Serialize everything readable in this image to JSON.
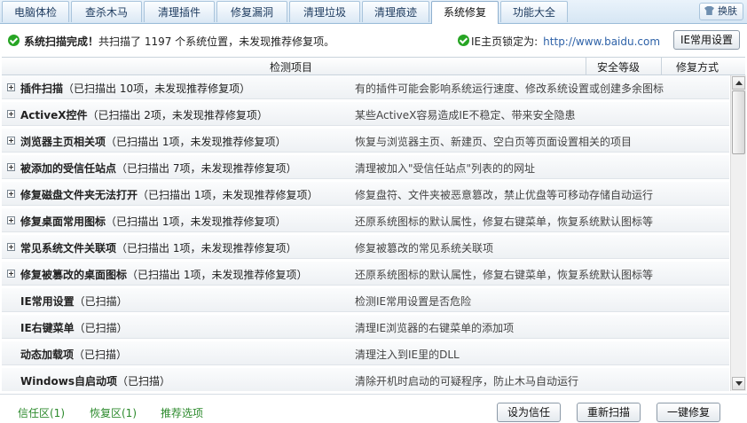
{
  "tabs": [
    {
      "label": "电脑体检"
    },
    {
      "label": "查杀木马"
    },
    {
      "label": "清理插件"
    },
    {
      "label": "修复漏洞"
    },
    {
      "label": "清理垃圾"
    },
    {
      "label": "清理痕迹"
    },
    {
      "label": "系统修复",
      "active": true
    },
    {
      "label": "功能大全"
    }
  ],
  "skin_label": "换肤",
  "status": {
    "title": "系统扫描完成！",
    "message": "共扫描了 1197 个系统位置，未发现推荐修复项。",
    "ie_lock_label": "IE主页锁定为:",
    "ie_url": "http://www.baidu.com",
    "ie_settings_button": "IE常用设置"
  },
  "columns": {
    "item": "检测项目",
    "level": "安全等级",
    "method": "修复方式"
  },
  "rows": [
    {
      "name": "插件扫描",
      "detail": "（已扫描出 10项，未发现推荐修复项）",
      "desc": "有的插件可能会影响系统运行速度、修改系统设置或创建多余图标",
      "expandable": true
    },
    {
      "name": "ActiveX控件",
      "detail": "（已扫描出 2项，未发现推荐修复项）",
      "desc": "某些ActiveX容易造成IE不稳定、带来安全隐患",
      "expandable": true
    },
    {
      "name": "浏览器主页相关项",
      "detail": "（已扫描出 1项，未发现推荐修复项）",
      "desc": "恢复与浏览器主页、新建页、空白页等页面设置相关的项目",
      "expandable": true
    },
    {
      "name": "被添加的受信任站点",
      "detail": "（已扫描出 7项，未发现推荐修复项）",
      "desc": "清理被加入\"受信任站点\"列表的的网址",
      "expandable": true
    },
    {
      "name": "修复磁盘文件夹无法打开",
      "detail": "（已扫描出 1项，未发现推荐修复项）",
      "desc": "修复盘符、文件夹被恶意篡改，禁止优盘等可移动存储自动运行",
      "expandable": true
    },
    {
      "name": "修复桌面常用图标",
      "detail": "（已扫描出 1项，未发现推荐修复项）",
      "desc": "还原系统图标的默认属性，修复右键菜单，恢复系统默认图标等",
      "expandable": true
    },
    {
      "name": "常见系统文件关联项",
      "detail": "（已扫描出 1项，未发现推荐修复项）",
      "desc": "修复被篡改的常见系统关联项",
      "expandable": true
    },
    {
      "name": "修复被篡改的桌面图标",
      "detail": "（已扫描出 1项，未发现推荐修复项）",
      "desc": "还原系统图标的默认属性，修复右键菜单，恢复系统默认图标等",
      "expandable": true
    },
    {
      "name": "IE常用设置",
      "detail": "（已扫描）",
      "desc": "检测IE常用设置是否危险",
      "expandable": false
    },
    {
      "name": "IE右键菜单",
      "detail": "（已扫描）",
      "desc": "清理IE浏览器的右键菜单的添加项",
      "expandable": false
    },
    {
      "name": "动态加载项",
      "detail": "（已扫描）",
      "desc": "清理注入到IE里的DLL",
      "expandable": false
    },
    {
      "name": "Windows自启动项",
      "detail": "（已扫描）",
      "desc": "清除开机时启动的可疑程序，防止木马自动运行",
      "expandable": false
    }
  ],
  "footer": {
    "trust_zone": "信任区(1)",
    "restore_zone": "恢复区(1)",
    "recommended": "推荐选项",
    "set_trust_button": "设为信任",
    "rescan_button": "重新扫描",
    "fix_button": "一键修复"
  }
}
